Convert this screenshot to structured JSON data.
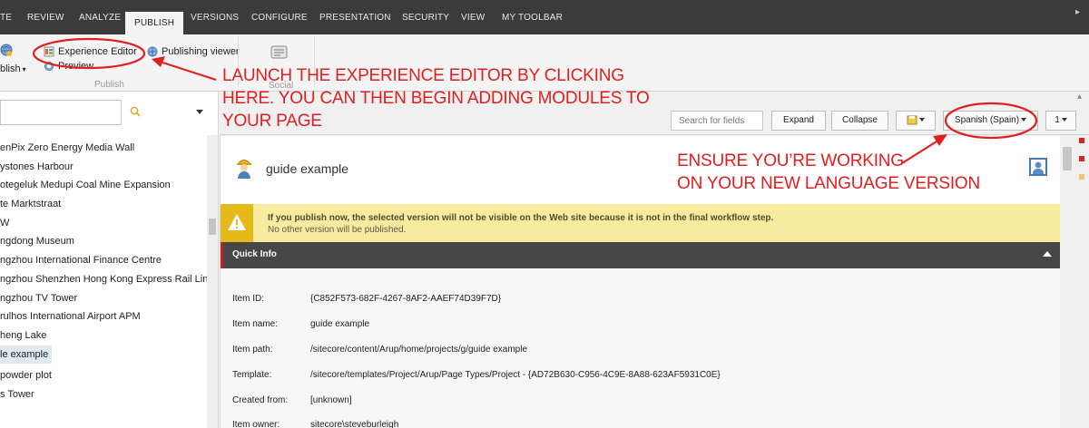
{
  "menu": {
    "tabs": [
      "TE",
      "REVIEW",
      "ANALYZE",
      "PUBLISH",
      "VERSIONS",
      "CONFIGURE",
      "PRESENTATION",
      "SECURITY",
      "VIEW",
      "MY TOOLBAR"
    ],
    "active_tab": "PUBLISH"
  },
  "ribbon": {
    "publish_label": "blish",
    "experience_editor": "Experience Editor",
    "preview": "Preview",
    "publishing_viewer": "Publishing viewer",
    "group_publish": "Publish",
    "group_social": "Social"
  },
  "tree": {
    "items": [
      "enPix Zero Energy Media Wall",
      "ystones Harbour",
      "otegeluk Medupi Coal Mine Expansion",
      "te Marktstraat",
      "W",
      "ngdong Museum",
      "ngzhou International Finance Centre",
      "ngzhou Shenzhen Hong Kong Express Rail Link",
      "ngzhou TV Tower",
      "rulhos International Airport APM",
      "heng Lake",
      "le example",
      "powder plot",
      "s Tower"
    ],
    "selected_index": 11
  },
  "toolbar": {
    "search_placeholder": "Search for fields",
    "expand": "Expand",
    "collapse": "Collapse",
    "language": "Spanish (Spain)",
    "version": "1"
  },
  "item": {
    "title": "guide example"
  },
  "warning": {
    "line1": "If you publish now, the selected version will not be visible on the Web site because it is not in the final workflow step.",
    "line2": "No other version will be published."
  },
  "quick_info": {
    "title": "Quick Info",
    "rows": [
      {
        "key": "Item ID:",
        "value": "{C852F573-682F-4267-8AF2-AAEF74D39F7D}"
      },
      {
        "key": "Item name:",
        "value": "guide example"
      },
      {
        "key": "Item path:",
        "value": "/sitecore/content/Arup/home/projects/g/guide example"
      },
      {
        "key": "Template:",
        "value": "/sitecore/templates/Project/Arup/Page Types/Project - {AD72B630-C956-4C9E-8A88-623AF5931C0E}"
      },
      {
        "key": "Created from:",
        "value": "[unknown]"
      },
      {
        "key": "Item owner:",
        "value": "sitecore\\steveburleigh"
      }
    ]
  },
  "annotations": {
    "launch": [
      "LAUNCH THE EXPERIENCE EDITOR BY CLICKING",
      "HERE. YOU CAN THEN BEGIN ADDING MODULES TO",
      "YOUR PAGE"
    ],
    "ensure": [
      "ENSURE YOU’RE WORKING",
      "ON YOUR NEW LANGUAGE VERSION"
    ]
  },
  "colors": {
    "annotation_red": "#e02020",
    "menu_bg": "#3b3b3b",
    "quick_info_bg": "#474747",
    "warning_bg": "#f8eba0",
    "warning_icon_bg": "#e5b919",
    "accent_blue": "#4a78b4"
  }
}
